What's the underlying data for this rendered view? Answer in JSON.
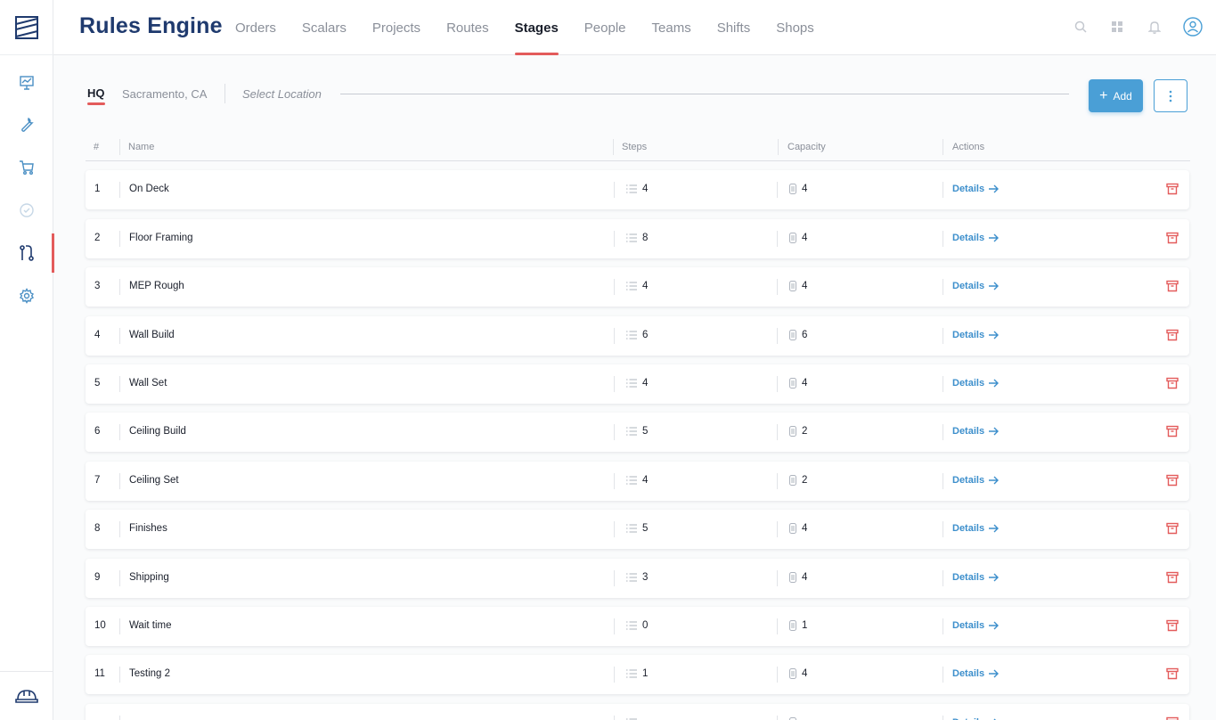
{
  "app": {
    "title": "Rules Engine"
  },
  "nav": {
    "items": [
      "Orders",
      "Scalars",
      "Projects",
      "Routes",
      "Stages",
      "People",
      "Teams",
      "Shifts",
      "Shops"
    ],
    "active": "Stages"
  },
  "location": {
    "hq_label": "HQ",
    "city": "Sacramento, CA",
    "select_placeholder": "Select Location"
  },
  "toolbar": {
    "add_label": "Add"
  },
  "table": {
    "columns": {
      "index": "#",
      "name": "Name",
      "steps": "Steps",
      "capacity": "Capacity",
      "actions": "Actions"
    },
    "details_label": "Details",
    "rows": [
      {
        "index": "1",
        "name": "On Deck",
        "steps": "4",
        "capacity": "4"
      },
      {
        "index": "2",
        "name": "Floor Framing",
        "steps": "8",
        "capacity": "4"
      },
      {
        "index": "3",
        "name": "MEP Rough",
        "steps": "4",
        "capacity": "4"
      },
      {
        "index": "4",
        "name": "Wall Build",
        "steps": "6",
        "capacity": "6"
      },
      {
        "index": "5",
        "name": "Wall Set",
        "steps": "4",
        "capacity": "4"
      },
      {
        "index": "6",
        "name": "Ceiling Build",
        "steps": "5",
        "capacity": "2"
      },
      {
        "index": "7",
        "name": "Ceiling Set",
        "steps": "4",
        "capacity": "2"
      },
      {
        "index": "8",
        "name": "Finishes",
        "steps": "5",
        "capacity": "4"
      },
      {
        "index": "9",
        "name": "Shipping",
        "steps": "3",
        "capacity": "4"
      },
      {
        "index": "10",
        "name": "Wait time",
        "steps": "0",
        "capacity": "1"
      },
      {
        "index": "11",
        "name": "Testing 2",
        "steps": "1",
        "capacity": "4"
      },
      {
        "index": "",
        "name": "",
        "steps": "",
        "capacity": ""
      }
    ]
  },
  "icons": {
    "sidebar": [
      "logo-icon",
      "chart-board-icon",
      "wrench-icon",
      "cart-icon",
      "check-circle-icon",
      "route-icon",
      "gear-icon",
      "hardhat-icon"
    ],
    "header": [
      "search-icon",
      "grid-icon",
      "bell-icon",
      "user-icon"
    ],
    "row": [
      "steps-list-icon",
      "capacity-icon",
      "arrow-right-icon",
      "trash-icon"
    ]
  },
  "colors": {
    "brand": "#1f3a6e",
    "accent": "#e35b5b",
    "primary": "#4a9fd6",
    "link": "#3d8fcc",
    "danger": "#e35b5b"
  }
}
